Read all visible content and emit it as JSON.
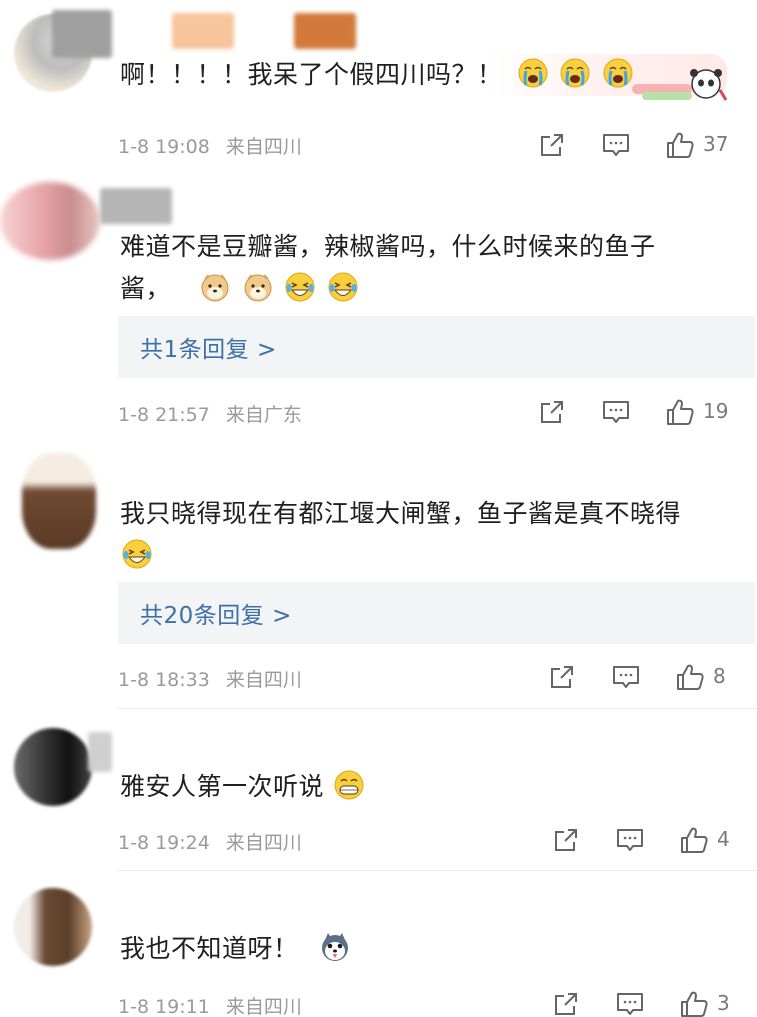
{
  "comments": [
    {
      "text": "啊！！！！我呆了个假四川吗？！",
      "date": "1-8 19:08",
      "location": "来自四川",
      "likes": "37",
      "emoji": [
        "crying-face",
        "crying-face",
        "crying-face"
      ]
    },
    {
      "text_line1": "难道不是豆瓣酱，辣椒酱吗，什么时候来的鱼子",
      "text_line2": "酱，",
      "date": "1-8 21:57",
      "location": "来自广东",
      "likes": "19",
      "reply_link": "共1条回复 >",
      "emoji": [
        "doge-face",
        "doge-face",
        "laughing-tears-face",
        "laughing-tears-face"
      ]
    },
    {
      "text": "我只晓得现在有都江堰大闸蟹，鱼子酱是真不晓得",
      "date": "1-8 18:33",
      "location": "来自四川",
      "likes": "8",
      "reply_link": "共20条回复 >",
      "emoji": [
        "laughing-tears-face"
      ]
    },
    {
      "text": "雅安人第一次听说",
      "date": "1-8 19:24",
      "location": "来自四川",
      "likes": "4",
      "emoji": [
        "grinning-teeth-face"
      ]
    },
    {
      "text": "我也不知道呀！",
      "date": "1-8 19:11",
      "location": "来自四川",
      "likes": "3",
      "emoji": [
        "husky-dog-face"
      ]
    }
  ],
  "icons": {
    "share": "share-icon",
    "comment": "comment-icon",
    "like": "thumbs-up-icon"
  },
  "colors": {
    "reply_link": "#3d6fa8",
    "meta": "#9a9a9a",
    "reply_bg": "#f3f4f6"
  }
}
